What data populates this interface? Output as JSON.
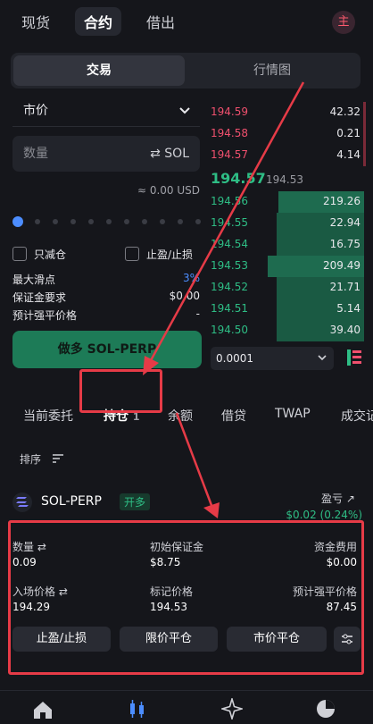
{
  "top_tabs": {
    "spot": "现货",
    "contract": "合约",
    "lending": "借出",
    "avatar": "主"
  },
  "view_tabs": {
    "trade": "交易",
    "chart": "行情图"
  },
  "order_form": {
    "order_type": "市价",
    "qty_placeholder": "数量",
    "unit": "SOL",
    "usd_value": "≈ 0.00 USD",
    "reduce_only": "只减仓",
    "tp_sl": "止盈/止损",
    "max_slippage_label": "最大滑点",
    "max_slippage_value": "3%",
    "margin_label": "保证金要求",
    "margin_value": "$0.00",
    "liq_label": "预计强平价格",
    "liq_value": "-",
    "buy_button": "做多 SOL-PERP"
  },
  "orderbook": {
    "asks": [
      {
        "price": "194.59",
        "size": "42.32"
      },
      {
        "price": "194.58",
        "size": "0.21"
      },
      {
        "price": "194.57",
        "size": "4.14"
      }
    ],
    "mid": {
      "price": "194.57",
      "mark": "194.53"
    },
    "bids": [
      {
        "price": "194.56",
        "size": "219.26"
      },
      {
        "price": "194.55",
        "size": "22.94"
      },
      {
        "price": "194.54",
        "size": "16.75"
      },
      {
        "price": "194.53",
        "size": "209.49"
      },
      {
        "price": "194.52",
        "size": "21.71"
      },
      {
        "price": "194.51",
        "size": "5.14"
      },
      {
        "price": "194.50",
        "size": "39.40"
      }
    ],
    "tick": "0.0001"
  },
  "position_tabs": {
    "open_orders": "当前委托",
    "positions": "持仓",
    "positions_count": "1",
    "balances": "余额",
    "borrow": "借贷",
    "twap": "TWAP",
    "fills": "成交记"
  },
  "sort": {
    "label": "排序"
  },
  "position": {
    "symbol": "SOL-PERP",
    "side": "开多",
    "pnl_label": "盈亏",
    "pnl_value": "$0.02 (0.24%)",
    "qty_label": "数量",
    "qty_value": "0.09",
    "init_margin_label": "初始保证金",
    "init_margin_value": "$8.75",
    "funding_label": "资金费用",
    "funding_value": "$0.00",
    "entry_label": "入场价格",
    "entry_value": "194.29",
    "mark_label": "标记价格",
    "mark_value": "194.53",
    "liq_label": "预计强平价格",
    "liq_value": "87.45",
    "btn_tpsl": "止盈/止损",
    "btn_limit_close": "限价平仓",
    "btn_market_close": "市价平仓"
  },
  "colors": {
    "green": "#2ebd85",
    "red": "#f0506e",
    "annotation": "#e63b47"
  }
}
